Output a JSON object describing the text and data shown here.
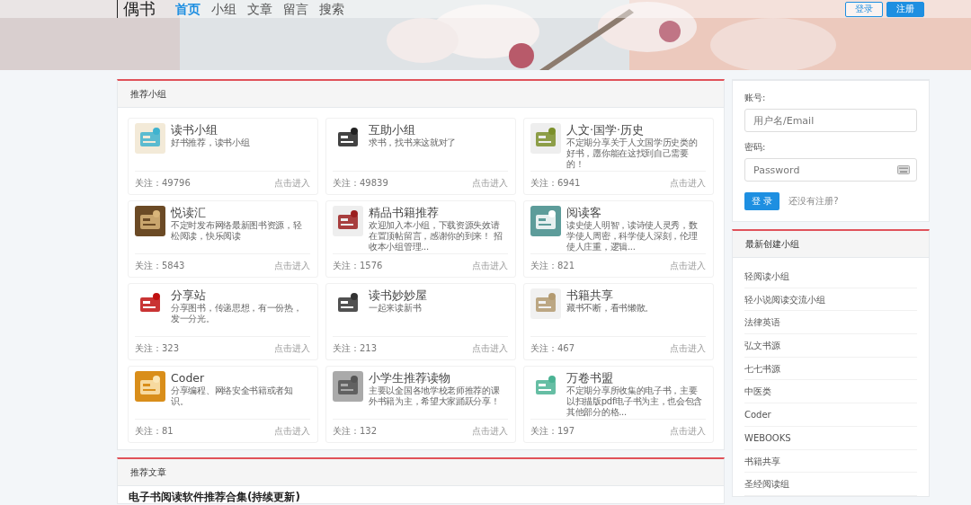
{
  "header": {
    "logo": "偶书",
    "nav": [
      {
        "label": "首页",
        "selected": true
      },
      {
        "label": "小组",
        "selected": false
      },
      {
        "label": "文章",
        "selected": false
      },
      {
        "label": "留言",
        "selected": false
      },
      {
        "label": "搜索",
        "selected": false
      }
    ],
    "login_button": "登录",
    "register_button": "注册"
  },
  "groups_panel": {
    "title": "推荐小组",
    "groups": [
      {
        "name": "读书小组",
        "desc": "好书推荐，读书小组",
        "followers": "关注：49796",
        "enter": "点击进入"
      },
      {
        "name": "互助小组",
        "desc": "求书，找书来这就对了",
        "followers": "关注：49839",
        "enter": "点击进入"
      },
      {
        "name": "人文·国学·历史",
        "desc": "不定期分享关于人文国学历史类的好书，愿你能在这找到自己需要的！",
        "followers": "关注：6941",
        "enter": "点击进入"
      },
      {
        "name": "悦读汇",
        "desc": "不定时发布网络最新图书资源，轻松阅读，快乐阅读",
        "followers": "关注：5843",
        "enter": "点击进入"
      },
      {
        "name": "精品书籍推荐",
        "desc": "欢迎加入本小组，下载资源失效请在置顶帖留言，感谢你的到来！ 招收本小组管理...",
        "followers": "关注：1576",
        "enter": "点击进入"
      },
      {
        "name": "阅读客",
        "desc": "读史使人明智，读诗使人灵秀，数学使人周密，科学使人深刻，伦理使人庄重，逻辑...",
        "followers": "关注：821",
        "enter": "点击进入"
      },
      {
        "name": "分享站",
        "desc": "分享图书，传递思想，有一份热，发一分光。",
        "followers": "关注：323",
        "enter": "点击进入"
      },
      {
        "name": "读书妙妙屋",
        "desc": "一起来读新书",
        "followers": "关注：213",
        "enter": "点击进入"
      },
      {
        "name": "书籍共享",
        "desc": "藏书不断，看书懒散。",
        "followers": "关注：467",
        "enter": "点击进入"
      },
      {
        "name": "Coder",
        "desc": "分享编程、网络安全书籍或者知识。",
        "followers": "关注：81",
        "enter": "点击进入"
      },
      {
        "name": "小学生推荐读物",
        "desc": "主要以全国各地学校老师推荐的课外书籍为主，希望大家踊跃分享！",
        "followers": "关注：132",
        "enter": "点击进入"
      },
      {
        "name": "万卷书盟",
        "desc": "不定期分享所收集的电子书，主要以扫描版pdf电子书为主，也会包含其他部分的格...",
        "followers": "关注：197",
        "enter": "点击进入"
      }
    ]
  },
  "articles_panel": {
    "title": "推荐文章",
    "first_article": "电子书阅读软件推荐合集(持续更新)"
  },
  "login_form": {
    "account_label": "账号:",
    "account_placeholder": "用户名/Email",
    "password_label": "密码:",
    "password_placeholder": "Password",
    "submit": "登 录",
    "register_link": "还没有注册?"
  },
  "recent_groups": {
    "title": "最新创建小组",
    "items": [
      "轻阅读小组",
      "轻小说阅读交流小组",
      "法律英语",
      "弘文书源",
      "七七书源",
      "中医类",
      "Coder",
      "WEBOOKS",
      "书籍共享",
      "圣经阅读组"
    ]
  }
}
